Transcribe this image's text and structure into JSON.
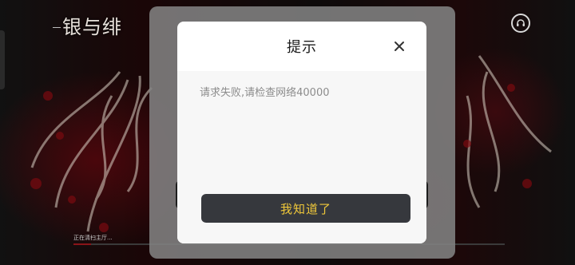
{
  "background": {
    "logo_text": "银与绯",
    "loading_text": "正在清扫主厅...",
    "loading_progress": 0.04,
    "corner_icon": "support-icon"
  },
  "dialog": {
    "title": "提示",
    "message": "请求失败,请检查网络40000",
    "confirm_label": "我知道了",
    "close_icon": "close-icon"
  },
  "colors": {
    "confirm_bg": "#36383d",
    "confirm_text": "#f0c83a",
    "overlay": "#828282",
    "accent_red": "#8a1418"
  }
}
